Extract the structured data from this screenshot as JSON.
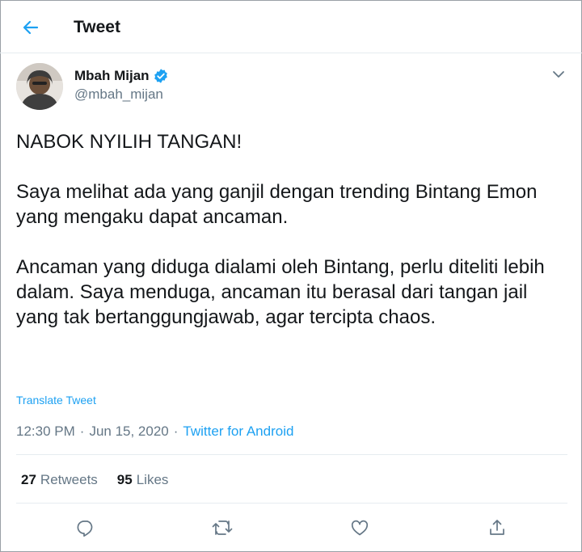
{
  "header": {
    "title": "Tweet",
    "back_icon": "back-arrow-icon"
  },
  "colors": {
    "accent": "#1da1f2",
    "text": "#14171a",
    "muted": "#657786",
    "divider": "#e6ecf0"
  },
  "author": {
    "name": "Mbah Mijan",
    "handle": "@mbah_mijan",
    "verified": true
  },
  "tweet": {
    "paragraphs": [
      "NABOK NYILIH TANGAN!",
      "Saya melihat ada yang ganjil dengan trending Bintang Emon yang mengaku dapat ancaman.",
      "Ancaman yang diduga dialami oleh Bintang, perlu diteliti lebih dalam. Saya menduga, ancaman itu berasal dari tangan jail yang tak bertanggungjawab, agar tercipta chaos."
    ],
    "translate_label": "Translate Tweet",
    "time": "12:30 PM",
    "separator": "·",
    "date": "Jun 15, 2020",
    "source": "Twitter for Android"
  },
  "stats": {
    "retweets_count": "27",
    "retweets_label": "Retweets",
    "likes_count": "95",
    "likes_label": "Likes"
  },
  "actions": [
    "reply-icon",
    "retweet-icon",
    "like-icon",
    "share-icon"
  ]
}
